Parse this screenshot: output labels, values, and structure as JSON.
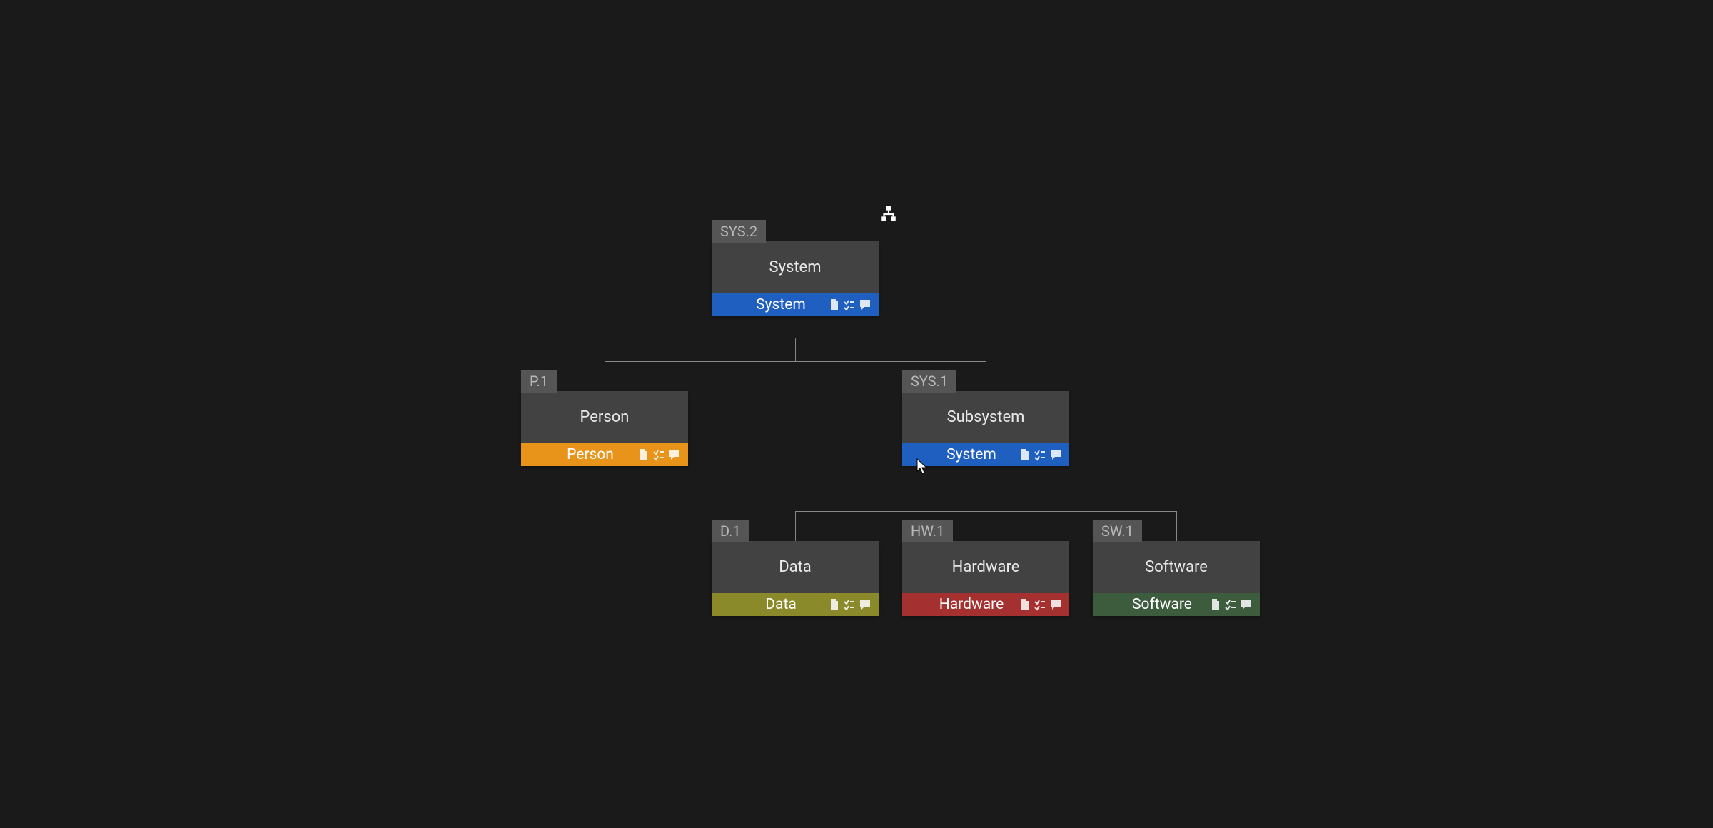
{
  "nodes": {
    "root": {
      "tag": "SYS.2",
      "title": "System",
      "type": "System"
    },
    "person": {
      "tag": "P.1",
      "title": "Person",
      "type": "Person"
    },
    "subsystem": {
      "tag": "SYS.1",
      "title": "Subsystem",
      "type": "System"
    },
    "data": {
      "tag": "D.1",
      "title": "Data",
      "type": "Data"
    },
    "hardware": {
      "tag": "HW.1",
      "title": "Hardware",
      "type": "Hardware"
    },
    "software": {
      "tag": "SW.1",
      "title": "Software",
      "type": "Software"
    }
  },
  "icons": {
    "document": "document-icon",
    "checklist": "checklist-icon",
    "comment": "comment-icon",
    "hierarchy": "hierarchy-icon"
  }
}
